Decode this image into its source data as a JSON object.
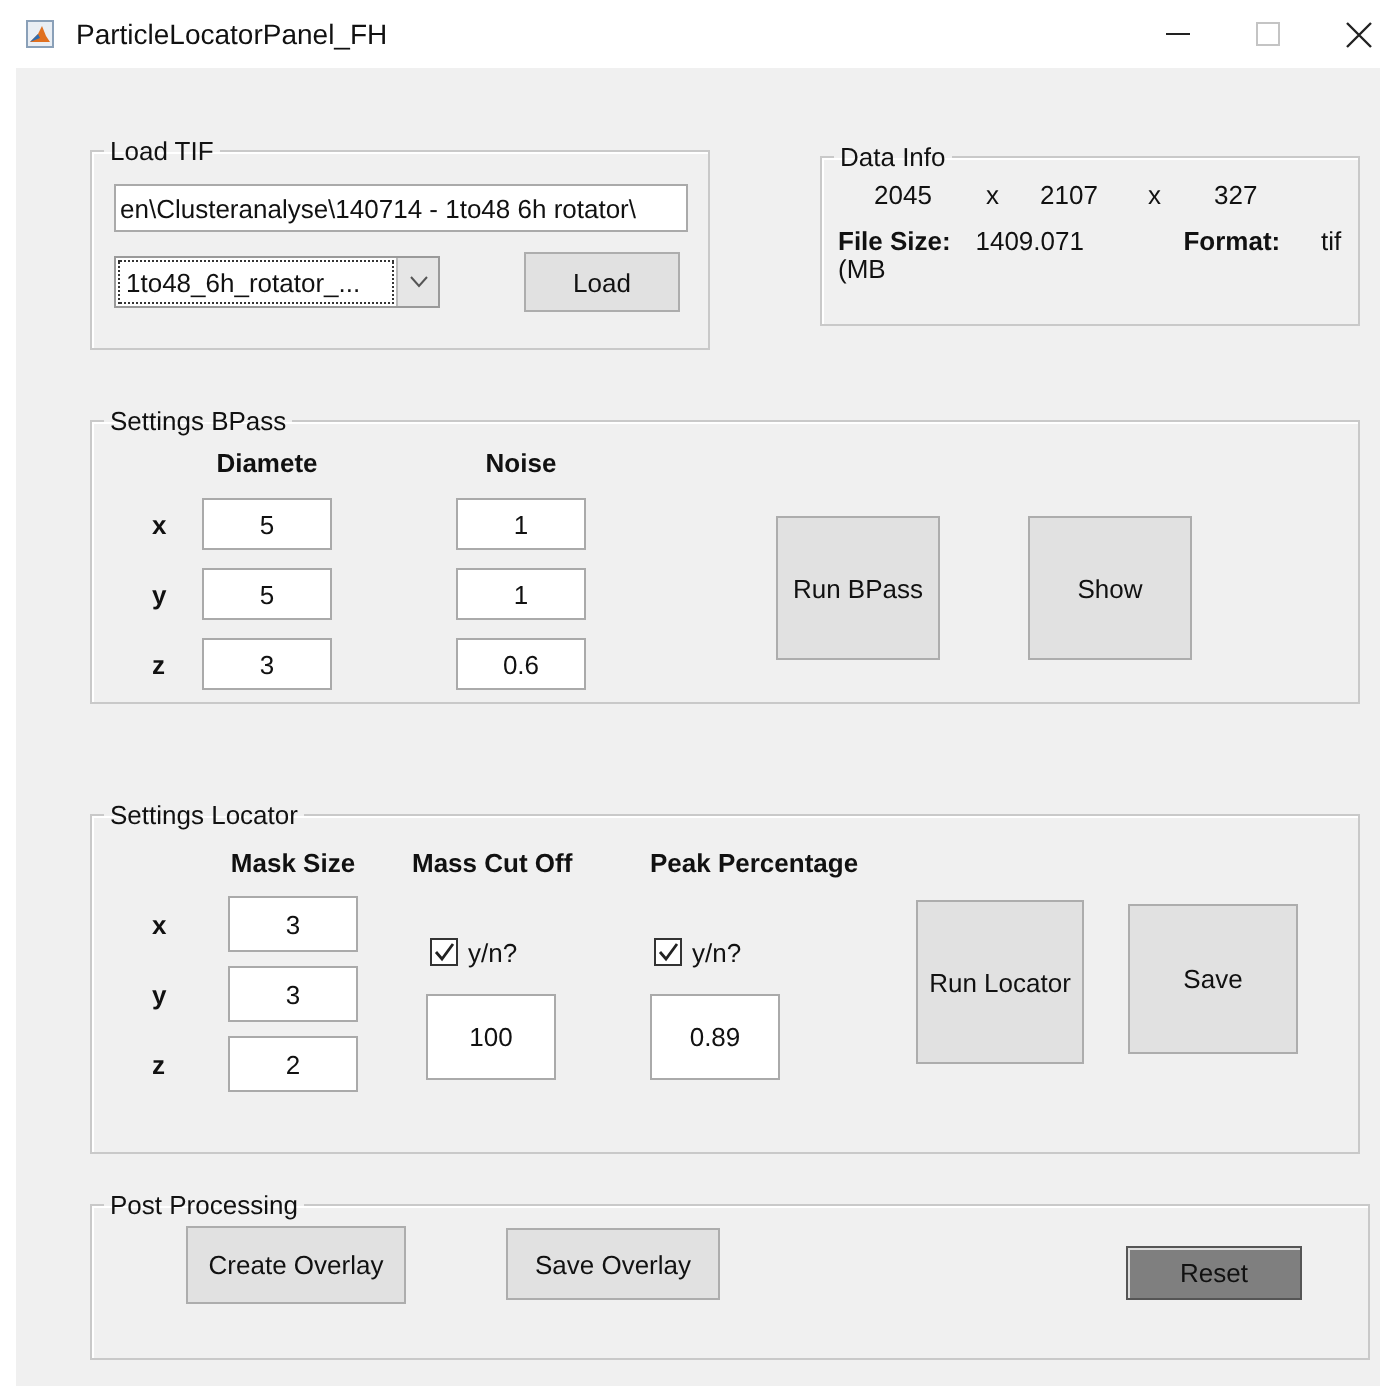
{
  "window": {
    "title": "ParticleLocatorPanel_FH"
  },
  "load_tif": {
    "title": "Load TIF",
    "path": "en\\Clusteranalyse\\140714 - 1to48 6h rotator\\",
    "file_dropdown": "1to48_6h_rotator_...",
    "button": "Load"
  },
  "data_info": {
    "title": "Data Info",
    "dims": [
      "2045",
      "x",
      "2107",
      "x",
      "327"
    ],
    "file_size_label": "File Size:",
    "file_size": "1409.071",
    "file_size_unit": "(MB",
    "format_label": "Format:",
    "format": "tif"
  },
  "bpass": {
    "title": "Settings BPass",
    "columns": [
      "Diamete",
      "Noise"
    ],
    "rows": [
      {
        "axis": "x",
        "diameter": "5",
        "noise": "1"
      },
      {
        "axis": "y",
        "diameter": "5",
        "noise": "1"
      },
      {
        "axis": "z",
        "diameter": "3",
        "noise": "0.6"
      }
    ],
    "buttons": [
      "Run BPass",
      "Show"
    ]
  },
  "locator": {
    "title": "Settings Locator",
    "columns": [
      "Mask Size",
      "Mass Cut Off",
      "Peak Percentage"
    ],
    "rows": [
      {
        "axis": "x",
        "mask_size": "3"
      },
      {
        "axis": "y",
        "mask_size": "3"
      },
      {
        "axis": "z",
        "mask_size": "2"
      }
    ],
    "options": [
      {
        "checkbox_label": "y/n?",
        "checked": true,
        "value": "100"
      },
      {
        "checkbox_label": "y/n?",
        "checked": true,
        "value": "0.89"
      }
    ],
    "buttons": [
      "Run Locator",
      "Save"
    ]
  },
  "post_processing": {
    "title": "Post Processing",
    "buttons": [
      {
        "label": "Create Overlay",
        "kind": "normal"
      },
      {
        "label": "Save Overlay",
        "kind": "normal"
      },
      {
        "label": "Reset",
        "kind": "dark"
      }
    ]
  }
}
